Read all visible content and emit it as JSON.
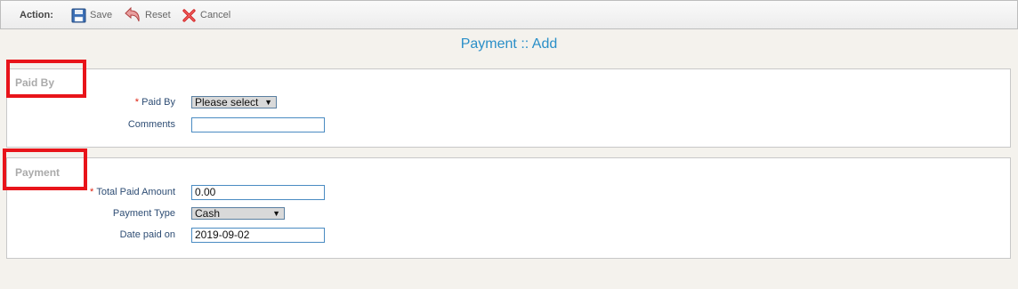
{
  "toolbar": {
    "action_label": "Action:",
    "save_label": "Save",
    "reset_label": "Reset",
    "cancel_label": "Cancel"
  },
  "page": {
    "title": "Payment :: Add"
  },
  "sections": {
    "paid_by": {
      "legend": "Paid By",
      "fields": {
        "paid_by": {
          "label": "Paid By",
          "required": "*",
          "value": "Please select"
        },
        "comments": {
          "label": "Comments",
          "value": ""
        }
      }
    },
    "payment": {
      "legend": "Payment",
      "fields": {
        "total_paid_amount": {
          "label": "Total Paid Amount",
          "required": "*",
          "value": "0.00"
        },
        "payment_type": {
          "label": "Payment Type",
          "value": "Cash"
        },
        "date_paid_on": {
          "label": "Date paid on",
          "value": "2019-09-02"
        }
      }
    }
  },
  "colors": {
    "accent": "#2a8fc8",
    "highlight_box": "#e8141a",
    "required": "#dd2211"
  },
  "icons": {
    "save": "floppy-disk-icon",
    "reset": "undo-arrow-icon",
    "cancel": "red-x-icon",
    "dropdown": "chevron-down-icon"
  }
}
